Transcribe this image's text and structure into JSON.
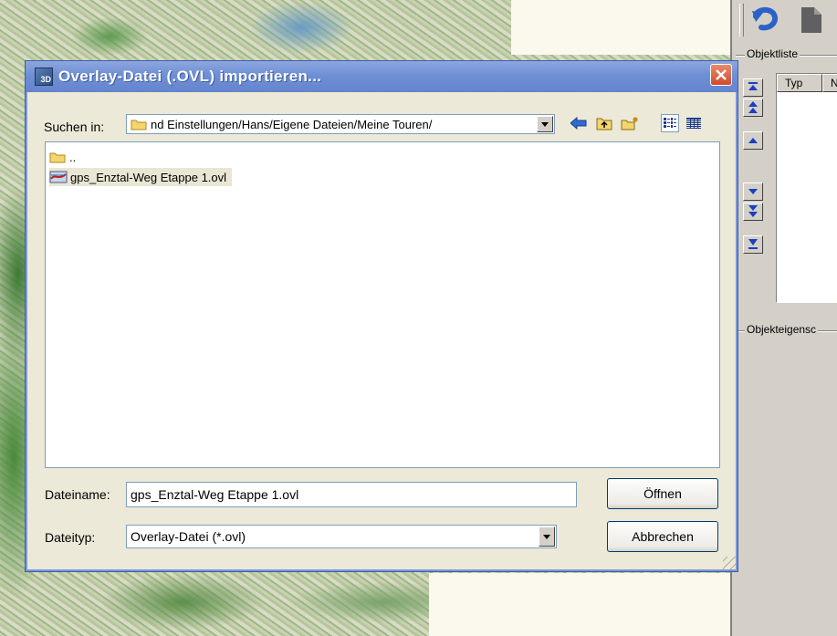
{
  "dialog": {
    "title": "Overlay-Datei (.OVL) importieren...",
    "app_icon_text": "3D",
    "look_in_label": "Suchen in:",
    "look_in_path": "nd Einstellungen/Hans/Eigene Dateien/Meine Touren/",
    "files": [
      {
        "name": "..",
        "type": "folder"
      },
      {
        "name": "gps_Enztal-Weg Etappe 1.ovl",
        "type": "ovl",
        "selected": true
      }
    ],
    "filename_label": "Dateiname:",
    "filename_value": "gps_Enztal-Weg Etappe 1.ovl",
    "filetype_label": "Dateityp:",
    "filetype_value": "Overlay-Datei (*.ovl)",
    "open_button": "Öffnen",
    "cancel_button": "Abbrechen",
    "toolbar_icons": [
      "back-arrow-icon",
      "up-folder-icon",
      "new-folder-icon",
      "list-view-icon",
      "details-view-icon"
    ]
  },
  "right_panel": {
    "object_list_title": "Objektliste",
    "list_columns": [
      "Typ",
      "N"
    ],
    "object_properties_title": "Objekteigensc",
    "toolbar_icons": [
      "undo-icon",
      "document-icon"
    ],
    "nav_buttons": [
      "move-top-icon",
      "move-up-double-icon",
      "move-up-icon",
      "move-down-icon",
      "move-down-double-icon",
      "move-bottom-icon"
    ]
  },
  "colors": {
    "titlebar": "#6f8fd4",
    "dialog_bg": "#ece9d8",
    "panel_bg": "#d4d0c8",
    "close_button": "#d04b2c"
  }
}
